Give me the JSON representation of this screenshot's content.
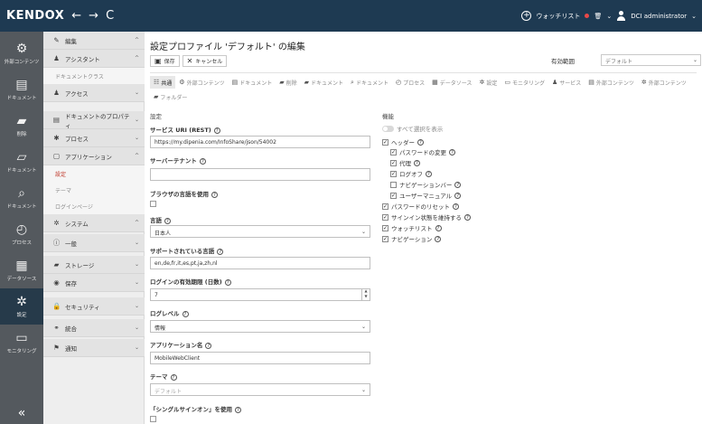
{
  "app": {
    "logo": "KENDOX",
    "back": "←",
    "forward": "→",
    "refresh": "C",
    "watchlist": "ウォッチリスト",
    "trash": "🗑",
    "user": "DCI administrator"
  },
  "rail": [
    {
      "icon": "⚙",
      "label": "外部コンテンツ",
      "name": "rail-external-content"
    },
    {
      "icon": "▤",
      "label": "ドキュメント",
      "name": "rail-documents"
    },
    {
      "icon": "▰",
      "label": "削除",
      "name": "rail-delete"
    },
    {
      "icon": "▱",
      "label": "ドキュメント",
      "name": "rail-documents-2"
    },
    {
      "icon": "⌕",
      "label": "ドキュメント",
      "name": "rail-search"
    },
    {
      "icon": "◴",
      "label": "プロセス",
      "name": "rail-processes"
    },
    {
      "icon": "▦",
      "label": "データソース",
      "name": "rail-datasources"
    },
    {
      "icon": "✲",
      "label": "設定",
      "name": "rail-settings"
    },
    {
      "icon": "▭",
      "label": "モニタリング",
      "name": "rail-monitoring"
    }
  ],
  "rail_collapse": "«",
  "nav2": [
    {
      "type": "head",
      "icon": "✎",
      "label": "編集",
      "chev": "^",
      "name": "nav-edit"
    },
    {
      "type": "head",
      "icon": "♟",
      "label": "アシスタント",
      "chev": "^",
      "name": "nav-assistant"
    },
    {
      "type": "sub",
      "label": "ドキュメントクラス",
      "name": "nav-document-class"
    },
    {
      "type": "head",
      "icon": "♟",
      "label": "アクセス",
      "chev": "⌄",
      "name": "nav-access"
    },
    {
      "type": "head",
      "icon": "▤",
      "label": "ドキュメントのプロパティ",
      "chev": "⌄",
      "name": "nav-document-properties"
    },
    {
      "type": "head",
      "icon": "✱",
      "label": "プロセス",
      "chev": "⌄",
      "name": "nav-processes"
    },
    {
      "type": "head",
      "icon": "▢",
      "label": "アプリケーション",
      "chev": "^",
      "name": "nav-application"
    },
    {
      "type": "sub",
      "label": "設定",
      "active": true,
      "name": "nav-settings"
    },
    {
      "type": "sub",
      "label": "テーマ",
      "name": "nav-theme"
    },
    {
      "type": "sub",
      "label": "ログインページ",
      "name": "nav-login-page"
    },
    {
      "type": "head",
      "icon": "✲",
      "label": "システム",
      "chev": "^",
      "name": "nav-system"
    },
    {
      "type": "head",
      "icon": "ⓘ",
      "label": "一般",
      "chev": "⌄",
      "name": "nav-general"
    },
    {
      "type": "head",
      "icon": "▰",
      "label": "ストレージ",
      "chev": "⌄",
      "name": "nav-storage"
    },
    {
      "type": "head",
      "icon": "◉",
      "label": "保存",
      "chev": "⌄",
      "name": "nav-save"
    },
    {
      "type": "head",
      "icon": "🔒",
      "label": "セキュリティ",
      "chev": "⌄",
      "name": "nav-security"
    },
    {
      "type": "head",
      "icon": "⚭",
      "label": "統合",
      "chev": "⌄",
      "name": "nav-integration"
    },
    {
      "type": "head",
      "icon": "⚑",
      "label": "通知",
      "chev": "⌄",
      "name": "nav-notifications"
    }
  ],
  "main": {
    "title": "設定プロファイル 'デフォルト' の編集",
    "save": "保存",
    "cancel": "キャンセル",
    "scope_label": "有効範囲",
    "scope_value": "デフォルト",
    "tabs": [
      {
        "icon": "☷",
        "label": "共通",
        "active": true
      },
      {
        "icon": "⚙",
        "label": "外部コンテンツ"
      },
      {
        "icon": "▤",
        "label": "ドキュメント"
      },
      {
        "icon": "▰",
        "label": "削除"
      },
      {
        "icon": "▰",
        "label": "ドキュメント"
      },
      {
        "icon": "⌕",
        "label": "ドキュメント"
      },
      {
        "icon": "◴",
        "label": "プロセス"
      },
      {
        "icon": "▦",
        "label": "データソース"
      },
      {
        "icon": "✲",
        "label": "設定"
      },
      {
        "icon": "▭",
        "label": "モニタリング"
      },
      {
        "icon": "♟",
        "label": "サービス"
      },
      {
        "icon": "▤",
        "label": "外部コンテンツ"
      },
      {
        "icon": "✲",
        "label": "外部コンテンツ"
      },
      {
        "icon": "▰",
        "label": "フォルダー"
      }
    ],
    "settings_title": "設定",
    "functions_title": "機能",
    "service_uri_label": "サービス URI (REST)",
    "service_uri_value": "https://my.dipenia.com/InfoShare/json/54002",
    "server_tenant_label": "サーバーテナント",
    "server_tenant_value": "",
    "browser_lang_label": "ブラウザの言語を使用",
    "language_label": "言語",
    "language_value": "日本人",
    "supported_langs_label": "サポートされている言語",
    "supported_langs_value": "en,de,fr,it,es,pt,ja,zh,nl",
    "login_validity_label": "ログインの有効期限 (日数)",
    "login_validity_value": "7",
    "log_level_label": "ログレベル",
    "log_level_value": "情報",
    "app_name_label": "アプリケーション名",
    "app_name_value": "MobileWebClient",
    "theme_label": "テーマ",
    "theme_value": "デフォルト",
    "sso_label": "「シングルサインオン」を使用",
    "toggle_all": "すべて選択を表示",
    "functions": [
      {
        "label": "ヘッダー",
        "checked": true,
        "indent": 0
      },
      {
        "label": "パスワードの変更",
        "checked": true,
        "indent": 1
      },
      {
        "label": "代理",
        "checked": true,
        "indent": 1
      },
      {
        "label": "ログオフ",
        "checked": true,
        "indent": 1
      },
      {
        "label": "ナビゲーションバー",
        "checked": false,
        "indent": 1
      },
      {
        "label": "ユーザーマニュアル",
        "checked": true,
        "indent": 1
      },
      {
        "label": "パスワードのリセット",
        "checked": true,
        "indent": 0
      },
      {
        "label": "サインイン状態を維持する",
        "checked": true,
        "indent": 0
      },
      {
        "label": "ウォッチリスト",
        "checked": true,
        "indent": 0
      },
      {
        "label": "ナビゲーション",
        "checked": true,
        "indent": 0
      }
    ],
    "help_icon": "?",
    "check_mark": "✓",
    "chevron_down": "⌄",
    "step_up": "▲",
    "step_down": "▼"
  },
  "colors": {
    "topbar": "#1e3a52",
    "rail": "#54595e",
    "rail_active": "#263a4a",
    "accent_red": "#c0392b"
  }
}
